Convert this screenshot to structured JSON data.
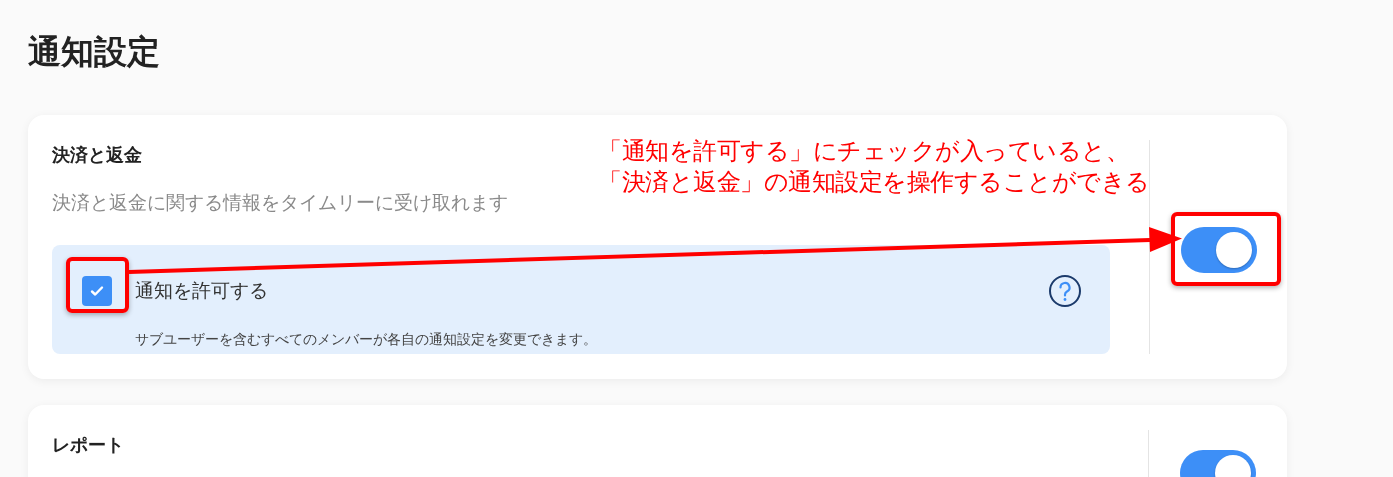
{
  "page_title": "通知設定",
  "sections": [
    {
      "title": "決済と返金",
      "description": "決済と返金に関する情報をタイムリーに受け取れます",
      "on": true,
      "permission": {
        "label": "通知を許可する",
        "checked": true,
        "note": "サブユーザーを含むすべてのメンバーが各自の通知設定を変更できます。"
      }
    },
    {
      "title": "レポート",
      "on": true
    }
  ],
  "annotation": {
    "lines": [
      "「通知を許可する」にチェックが入っていると、",
      "「決済と返金」の通知設定を操作することができる"
    ]
  }
}
